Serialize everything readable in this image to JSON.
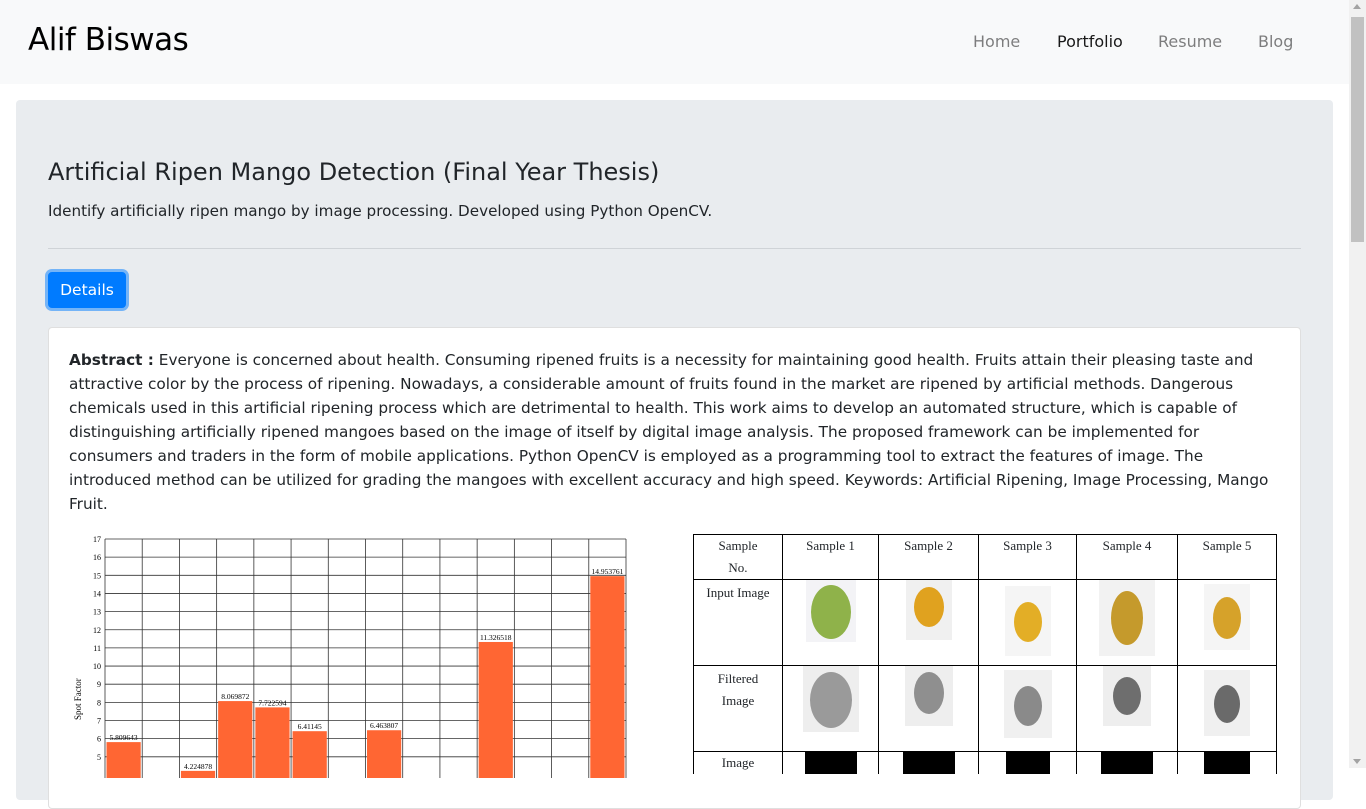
{
  "navbar": {
    "brand": "Alif Biswas",
    "links": [
      {
        "label": "Home",
        "active": false
      },
      {
        "label": "Portfolio",
        "active": true
      },
      {
        "label": "Resume",
        "active": false
      },
      {
        "label": "Blog",
        "active": false
      }
    ]
  },
  "project": {
    "title": "Artificial Ripen Mango Detection (Final Year Thesis)",
    "subtitle": "Identify artificially ripen mango by image processing. Developed using Python OpenCV.",
    "details_button": "Details",
    "abstract_label": "Abstract :",
    "abstract_text": "Everyone is concerned about health. Consuming ripened fruits is a necessity for maintaining good health. Fruits attain their pleasing taste and attractive color by the process of ripening. Nowadays, a considerable amount of fruits found in the market are ripened by artificial methods. Dangerous chemicals used in this artificial ripening process which are detrimental to health. This work aims to develop an automated structure, which is capable of distinguishing artificially ripened mangoes based on the image of itself by digital image analysis. The proposed framework can be implemented for consumers and traders in the form of mobile applications. Python OpenCV is employed as a programming tool to extract the features of image. The introduced method can be utilized for grading the mangoes with excellent accuracy and high speed. Keywords: Artificial Ripening, Image Processing, Mango Fruit."
  },
  "figure_chart": {
    "ylabel": "Spot Factor",
    "bar_color": "#ff6633"
  },
  "chart_data": {
    "type": "bar",
    "ylabel": "Spot Factor",
    "ylim": [
      0,
      17
    ],
    "yticks": [
      5,
      6,
      7,
      8,
      9,
      10,
      11,
      12,
      13,
      14,
      15,
      16,
      17
    ],
    "grid": true,
    "values": [
      5.809643,
      4.224878,
      8.069872,
      7.722594,
      6.41145,
      6.463807,
      11.326518,
      14.953761
    ],
    "value_labels": [
      "5.809643",
      "4.224878",
      "8.069872",
      "7.722594",
      "6.41145",
      "6.463807",
      "11.326518",
      "14.953761"
    ],
    "slots": [
      0,
      2,
      3,
      4,
      5,
      7,
      10,
      13
    ]
  },
  "samples_table": {
    "header_label": [
      "Sample",
      "No."
    ],
    "samples": [
      "Sample 1",
      "Sample 2",
      "Sample 3",
      "Sample 4",
      "Sample 5"
    ],
    "rows": {
      "input": "Input Image",
      "filtered": [
        "Filtered",
        "Image"
      ],
      "last": "Image"
    },
    "mango_colors": [
      "#8fb24a",
      "#e0a21f",
      "#e3ae26",
      "#c59a2c",
      "#d6a22a"
    ]
  }
}
